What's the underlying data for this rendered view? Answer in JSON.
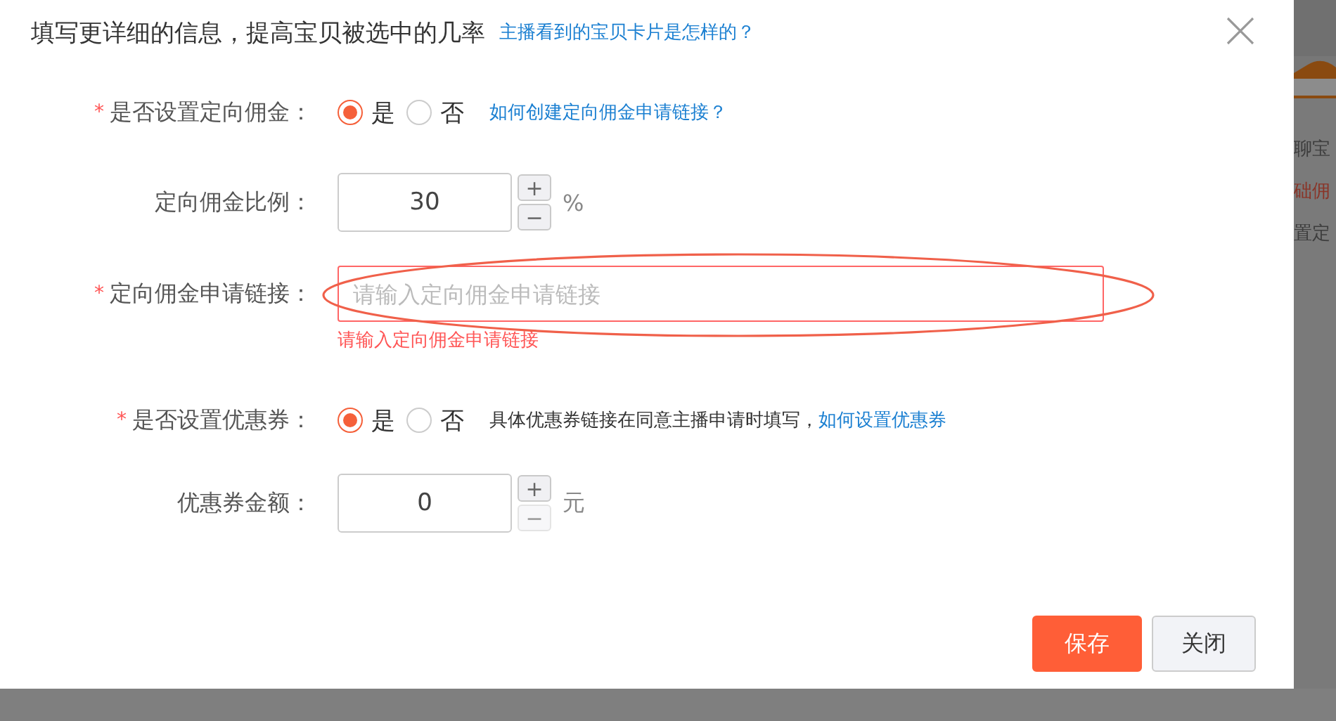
{
  "dialog": {
    "title": "填写更详细的信息，提高宝贝被选中的几率",
    "title_link": "主播看到的宝贝卡片是怎样的？",
    "fields": [
      {
        "kind": "radio",
        "marker": "*",
        "label": "是否设置定向佣金：",
        "options": [
          {
            "label": "是",
            "selected": true
          },
          {
            "label": "否",
            "selected": false
          }
        ],
        "note_link": "如何创建定向佣金申请链接？"
      },
      {
        "kind": "spinner",
        "label": "定向佣金比例：",
        "value": "30",
        "plus": {
          "label": "+",
          "disabled": false
        },
        "minus": {
          "label": "−",
          "disabled": false
        },
        "unit": "%"
      },
      {
        "kind": "text",
        "marker": "*",
        "label": "定向佣金申请链接：",
        "placeholder": "请输入定向佣金申请链接",
        "error": "请输入定向佣金申请链接",
        "annotated": true
      },
      {
        "kind": "radio",
        "marker": "*",
        "label": "是否设置优惠券：",
        "options": [
          {
            "label": "是",
            "selected": true
          },
          {
            "label": "否",
            "selected": false
          }
        ],
        "note": "具体优惠券链接在同意主播申请时填写，",
        "note_link": "如何设置优惠券"
      },
      {
        "kind": "spinner",
        "label": "优惠券金额：",
        "value": "0",
        "plus": {
          "label": "+",
          "disabled": false
        },
        "minus": {
          "label": "−",
          "disabled": true
        },
        "unit": "元"
      }
    ],
    "buttons": [
      {
        "label": "保存",
        "kind": "primary"
      },
      {
        "label": "关闭",
        "kind": "default"
      }
    ]
  },
  "background": {
    "items": [
      {
        "text": "聊宝",
        "kind": "plain"
      },
      {
        "text": "础佣",
        "kind": "alert"
      },
      {
        "text": "置定",
        "kind": "plain"
      }
    ]
  }
}
